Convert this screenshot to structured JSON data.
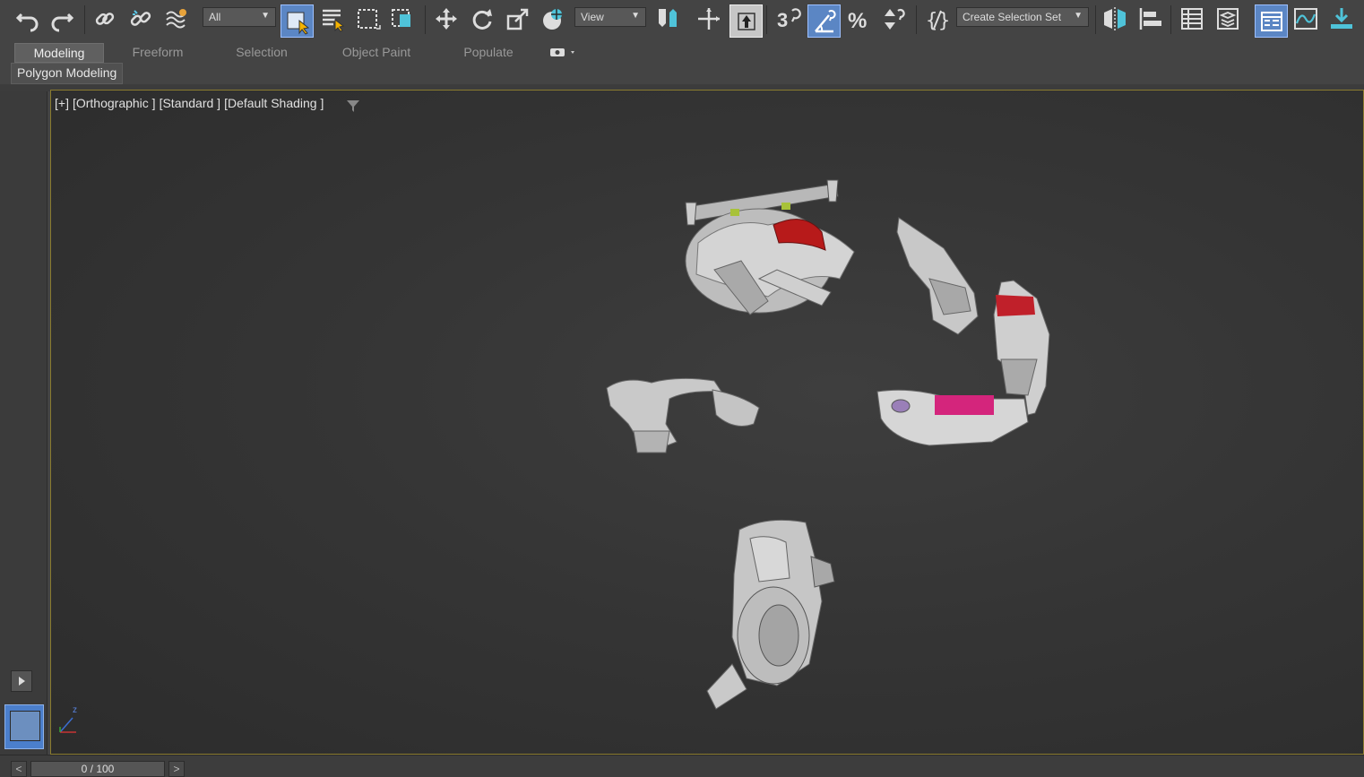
{
  "toolbar": {
    "selection_filter": "All",
    "ref_coord": "View",
    "selection_set": "Create Selection Set",
    "accent": "#5b86c4",
    "icons": [
      "undo-icon",
      "redo-icon",
      "link-icon",
      "unlink-icon",
      "bind-space-warp-icon",
      "select-object-icon",
      "select-by-name-icon",
      "rect-region-icon",
      "window-crossing-icon",
      "move-icon",
      "rotate-icon",
      "scale-icon",
      "place-icon",
      "mirror-axis-icon",
      "snap-toggle-icon",
      "angle-snap-icon",
      "percent-snap-icon",
      "spinner-snap-icon",
      "named-selection-edit-icon",
      "mirror-icon",
      "align-icon",
      "scene-explorer-icon",
      "layer-explorer-icon",
      "ribbon-toggle-icon",
      "curve-editor-icon",
      "schematic-icon"
    ]
  },
  "ribbon": {
    "tabs": [
      {
        "label": "Modeling",
        "active": true
      },
      {
        "label": "Freeform",
        "active": false
      },
      {
        "label": "Selection",
        "active": false
      },
      {
        "label": "Object Paint",
        "active": false
      },
      {
        "label": "Populate",
        "active": false
      }
    ],
    "panel_label": "Polygon Modeling"
  },
  "viewport": {
    "label_plus": "[+]",
    "label_view": "[Orthographic ]",
    "label_shading_type": "[Standard ]",
    "label_shading": "[Default Shading ]",
    "frame_color": "#8a7b2f",
    "axis_z": "z"
  },
  "timeline": {
    "value": "0 / 100",
    "prev": "<",
    "next": ">"
  }
}
